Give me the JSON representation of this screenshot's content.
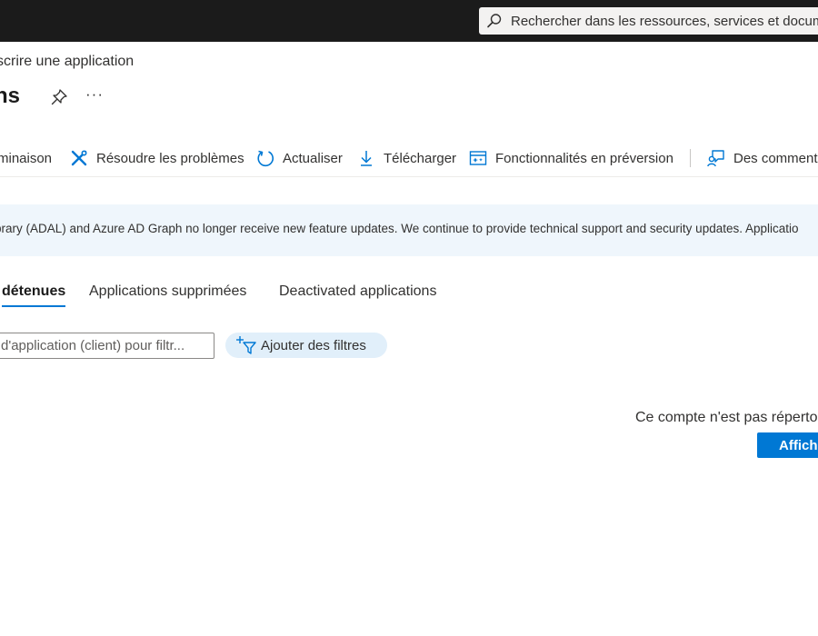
{
  "header": {
    "search_placeholder": "Rechercher dans les ressources, services et documents"
  },
  "breadcrumb": "scrire une application",
  "page": {
    "title": "ns",
    "more_label": "···"
  },
  "toolbar": {
    "items": [
      {
        "label": "minaison",
        "icon": "none"
      },
      {
        "label": "Résoudre les problèmes",
        "icon": "wrench-icon"
      },
      {
        "label": "Actualiser",
        "icon": "refresh-icon"
      },
      {
        "label": "Télécharger",
        "icon": "download-icon"
      },
      {
        "label": "Fonctionnalités en préversion",
        "icon": "preview-features-icon"
      },
      {
        "label": "Des comment",
        "icon": "feedback-icon"
      }
    ]
  },
  "banner": {
    "text": "brary (ADAL) and Azure AD Graph no longer receive new feature updates. We continue to provide technical support and security updates. Applicatio"
  },
  "tabs": [
    {
      "label": "détenues",
      "active": true
    },
    {
      "label": "Applications supprimées",
      "active": false
    },
    {
      "label": "Deactivated applications",
      "active": false
    }
  ],
  "filter": {
    "placeholder": "d'application (client) pour filtr...",
    "add_filters_label": "Ajouter des filtres"
  },
  "empty_state": {
    "message": "Ce compte n'est pas réperto",
    "button_label": "Affich"
  },
  "colors": {
    "topbar": "#1b1b1b",
    "accent": "#0078d4",
    "banner_bg": "#eff6fc",
    "chip_bg": "#e1effa"
  }
}
